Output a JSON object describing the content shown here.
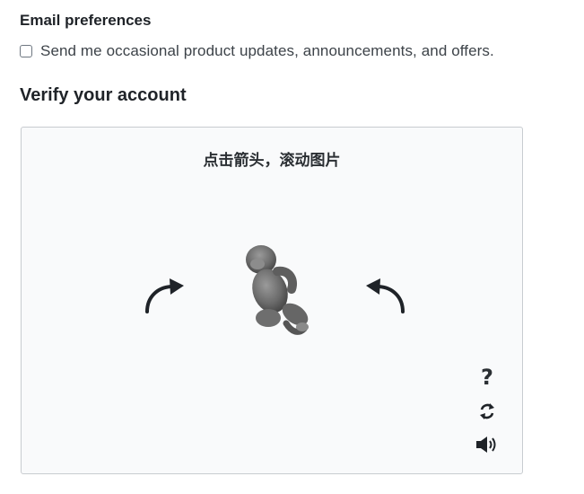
{
  "email_preferences": {
    "heading": "Email preferences",
    "checkbox_label": "Send me occasional product updates, announcements, and offers.",
    "checked": false
  },
  "verify": {
    "heading": "Verify your account",
    "captcha": {
      "instruction": "点击箭头，滚动图片",
      "left_arrow_icon": "rotate-left-arrow-icon",
      "right_arrow_icon": "rotate-right-arrow-icon",
      "image_subject": "monkey-figure",
      "help_icon": "question-mark-icon",
      "help_glyph": "?",
      "refresh_icon": "refresh-icon",
      "audio_icon": "speaker-icon"
    }
  },
  "colors": {
    "captcha_background": "#f9fafb",
    "captcha_border": "#c8ccd0",
    "text_dark": "#1f2328"
  }
}
